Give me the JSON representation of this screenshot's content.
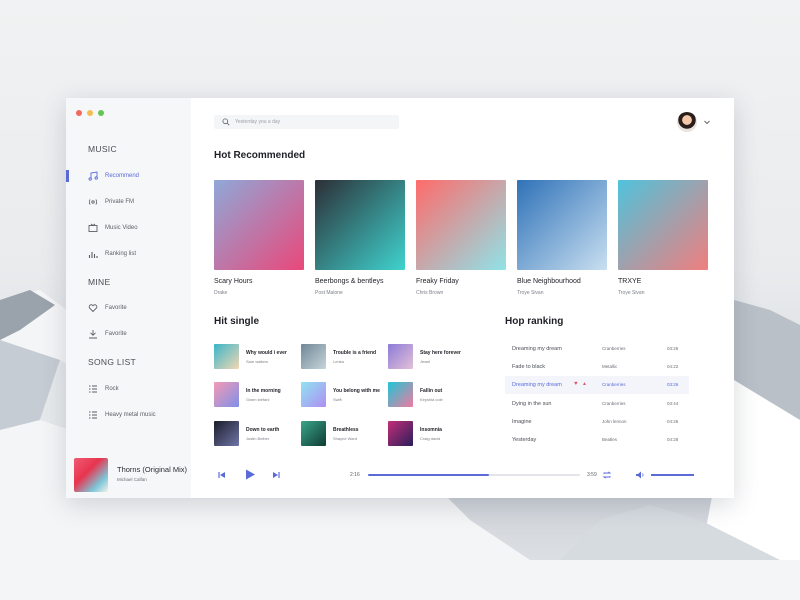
{
  "window": {
    "dot_colors": [
      "#f2695d",
      "#f5bd4f",
      "#62c654"
    ]
  },
  "sidebar": {
    "sections": [
      {
        "title": "MUSIC",
        "items": [
          {
            "label": "Recommend",
            "icon": "music-note-icon",
            "active": true
          },
          {
            "label": "Private FM",
            "icon": "radio-icon"
          },
          {
            "label": "Music Video",
            "icon": "video-icon"
          },
          {
            "label": "Ranking list",
            "icon": "chart-bars-icon"
          }
        ]
      },
      {
        "title": "MINE",
        "items": [
          {
            "label": "Favorite",
            "icon": "heart-icon"
          },
          {
            "label": "Favorite",
            "icon": "download-icon"
          }
        ]
      },
      {
        "title": "SONG LIST",
        "items": [
          {
            "label": "Rock",
            "icon": "list-icon"
          },
          {
            "label": "Heavy metal music",
            "icon": "list-icon"
          }
        ]
      }
    ],
    "now_playing": {
      "title": "Thorns (Original Mix)",
      "artist": "Michael Calfan"
    }
  },
  "search": {
    "placeholder": "Yesterday you a day",
    "icon": "search-icon"
  },
  "hot": {
    "title": "Hot Recommended",
    "albums": [
      {
        "title": "Scary Hours",
        "artist": "Drake",
        "color_a": "#8fa8d8",
        "color_b": "#e9487a"
      },
      {
        "title": "Beerbongs & bentleys",
        "artist": "Post Malone",
        "color_a": "#2c2f36",
        "color_b": "#3fd3cf"
      },
      {
        "title": "Freaky Friday",
        "artist": "Chris Brown",
        "color_a": "#ff6b6b",
        "color_b": "#8fe3e8"
      },
      {
        "title": "Blue Neighbourhood",
        "artist": "Troye Sivan",
        "color_a": "#2f72b8",
        "color_b": "#c9dff0"
      },
      {
        "title": "TRXYE",
        "artist": "Troye Sivan",
        "color_a": "#4fc3dc",
        "color_b": "#f07e7e"
      }
    ]
  },
  "hit": {
    "title": "Hit single",
    "songs": [
      {
        "title": "Why would i ever",
        "artist": "Sam walters",
        "color_a": "#3bb5c8",
        "color_b": "#f2d7b3"
      },
      {
        "title": "Trouble is a friend",
        "artist": "Lenka",
        "color_a": "#6f8796",
        "color_b": "#c7d5db"
      },
      {
        "title": "Stay here forever",
        "artist": "Jewel",
        "color_a": "#8d7bd8",
        "color_b": "#e3c0d8"
      },
      {
        "title": "In the morning",
        "artist": "Gwen stefani",
        "color_a": "#f59ab4",
        "color_b": "#7e90e8"
      },
      {
        "title": "You belong with me",
        "artist": "Swift",
        "color_a": "#8ee3f0",
        "color_b": "#b08ef3"
      },
      {
        "title": "Fallin out",
        "artist": "Keyshia cole",
        "color_a": "#1ec6d6",
        "color_b": "#f07aa0"
      },
      {
        "title": "Down to earth",
        "artist": "Justin Beiber",
        "color_a": "#1b1d2a",
        "color_b": "#6f76a8"
      },
      {
        "title": "Breathless",
        "artist": "Shayne Ward",
        "color_a": "#3aa68a",
        "color_b": "#0f3b33"
      },
      {
        "title": "Insomnia",
        "artist": "Craig david",
        "color_a": "#c32f78",
        "color_b": "#2a1d5a"
      }
    ]
  },
  "ranking": {
    "title": "Hop ranking",
    "rows": [
      {
        "title": "Dreaming my dream",
        "artist": "Cranberries",
        "duration": "03:26"
      },
      {
        "title": "Fade to black",
        "artist": "Metallic",
        "duration": "04:22"
      },
      {
        "title": "Dreaming my dream",
        "artist": "Cranberries",
        "duration": "03:26",
        "highlight": true
      },
      {
        "title": "Dying in the sun",
        "artist": "Cranberries",
        "duration": "03:44"
      },
      {
        "title": "Imagine",
        "artist": "John lennon",
        "duration": "04:26"
      },
      {
        "title": "Yesterday",
        "artist": "Beatles",
        "duration": "04:28"
      }
    ]
  },
  "player": {
    "current_time": "2:16",
    "total_time": "3:59",
    "progress": 0.57,
    "volume": 1.0,
    "accent": "#5a6bd8"
  }
}
